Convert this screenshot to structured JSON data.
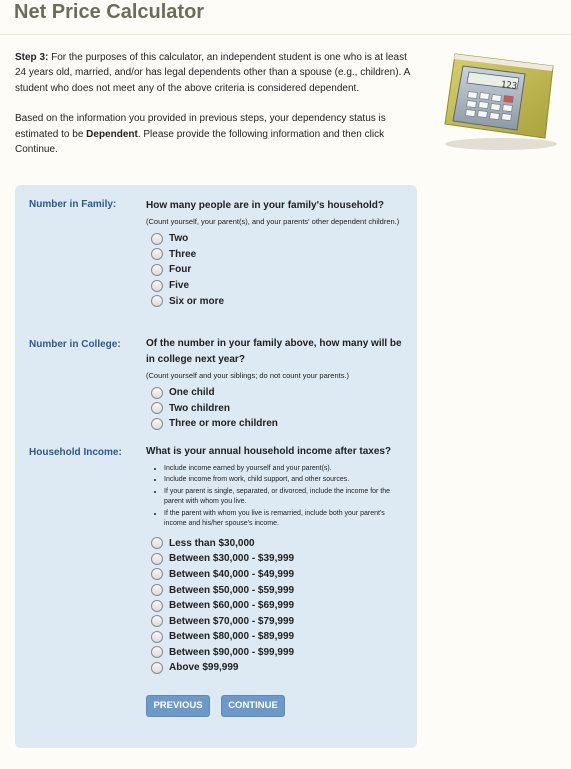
{
  "page": {
    "title": "Net Price Calculator"
  },
  "intro": {
    "step_label": "Step 3:",
    "step_text": " For the purposes of this calculator, an independent student is one who is at least 24 years old, married, and/or has legal dependents other than a spouse (e.g., children). A student who does not meet any of the above criteria is considered dependent.",
    "status_before": "Based on the information you provided in previous steps, your dependency status is estimated to be ",
    "status_value": "Dependent",
    "status_after": ". Please provide the following information and then click Continue."
  },
  "calculator_image": {
    "icon": "calculator-folder-icon",
    "display": "123"
  },
  "family": {
    "label": "Number in Family:",
    "question": "How many people are in your family's household?",
    "hint": "(Count yourself, your parent(s), and your parents' other dependent children.)",
    "options": [
      "Two",
      "Three",
      "Four",
      "Five",
      "Six or more"
    ]
  },
  "college": {
    "label": "Number in College:",
    "question": "Of the number in your family above, how many will be in college next year?",
    "hint": "(Count yourself and your siblings; do not count your parents.)",
    "options": [
      "One child",
      "Two children",
      "Three or more children"
    ]
  },
  "income": {
    "label": "Household Income:",
    "question": "What is your annual household income after taxes?",
    "bullets": [
      "Include income earned by yourself and your parent(s).",
      "Include income from work, child support, and other sources.",
      "If your parent is single, separated, or divorced, include the income for the parent with whom you live.",
      "If the parent with whom you live is remarried, include both your parent's income and his/her spouse's income."
    ],
    "options": [
      "Less than $30,000",
      "Between $30,000 - $39,999",
      "Between $40,000 - $49,999",
      "Between $50,000 - $59,999",
      "Between $60,000 - $69,999",
      "Between $70,000 - $79,999",
      "Between $80,000 - $89,999",
      "Between $90,000 - $99,999",
      "Above $99,999"
    ]
  },
  "buttons": {
    "previous": "PREVIOUS",
    "continue": "CONTINUE"
  }
}
